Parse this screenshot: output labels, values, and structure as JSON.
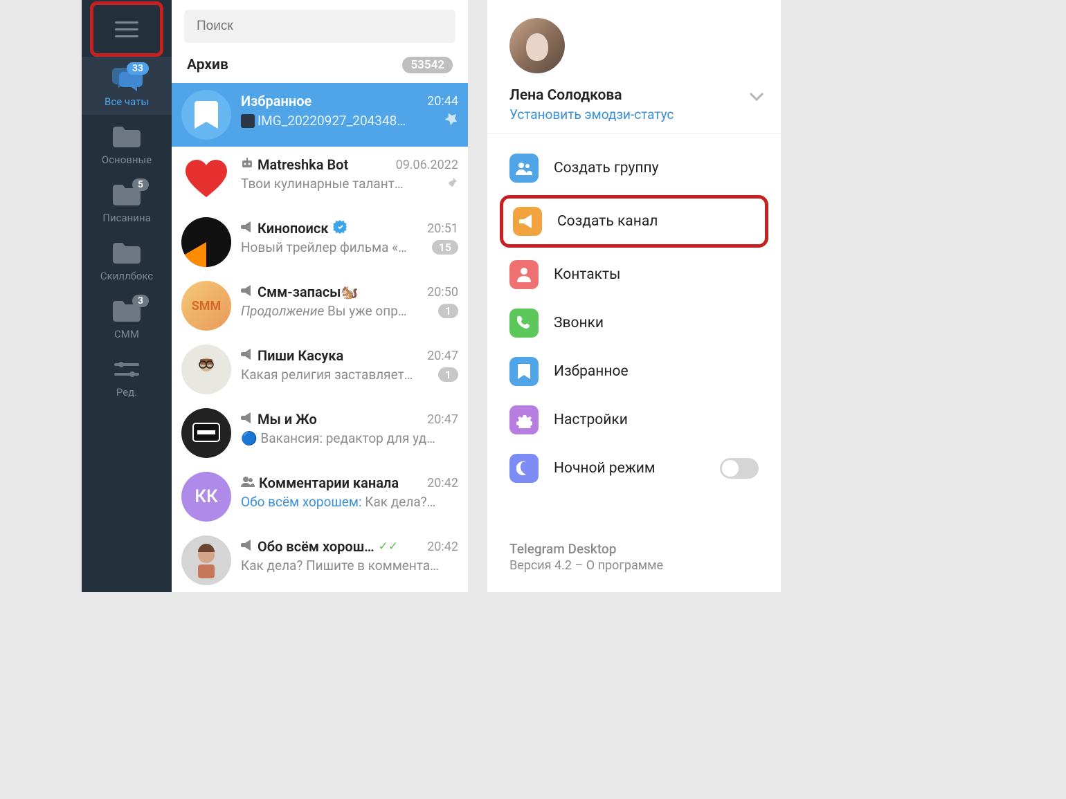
{
  "search": {
    "placeholder": "Поиск"
  },
  "sidebar": {
    "folders": [
      {
        "label": "Все чаты",
        "badge": "33",
        "active": true,
        "icon": "chats"
      },
      {
        "label": "Основные",
        "badge": null,
        "icon": "folder"
      },
      {
        "label": "Писанина",
        "badge": "5",
        "icon": "folder"
      },
      {
        "label": "Скиллбокс",
        "badge": null,
        "icon": "folder"
      },
      {
        "label": "СММ",
        "badge": "3",
        "icon": "folder"
      },
      {
        "label": "Ред.",
        "badge": null,
        "icon": "edit"
      }
    ]
  },
  "archive": {
    "label": "Архив",
    "count": "53542"
  },
  "chats": [
    {
      "title": "Избранное",
      "time": "20:44",
      "msg": "IMG_20220927_204348…",
      "pinned": true,
      "selected": true,
      "type": "saved"
    },
    {
      "title": "Matreshka Bot",
      "time": "09.06.2022",
      "msg": "Твои кулинарные талант…",
      "pinned": true,
      "type": "bot"
    },
    {
      "title": "Кинопоиск",
      "time": "20:51",
      "msg": "Новый трейлер фильма «…",
      "unread": "15",
      "verified": true,
      "type": "channel"
    },
    {
      "title": "Смм-запасы🐿️",
      "time": "20:50",
      "msg_prefix": "Продолжение",
      "msg": " Вы уже опр…",
      "unread": "1",
      "type": "channel"
    },
    {
      "title": "Пиши Касука",
      "time": "20:47",
      "msg": "Какая религия заставляет…",
      "unread": "1",
      "type": "channel"
    },
    {
      "title": "Мы и Жо",
      "time": "20:47",
      "msg": "🔵 Вакансия: редактор для уд…",
      "type": "channel"
    },
    {
      "title": "Комментарии канала",
      "time": "20:42",
      "msg_sender": "Обо всём хорошем:",
      "msg": " Как дела?…",
      "type": "group"
    },
    {
      "title": "Обо всём хорош…",
      "time": "20:42",
      "msg": "Как дела? Пишите в коммента…",
      "checks": true,
      "type": "channel"
    }
  ],
  "profile": {
    "name": "Лена Солодкова",
    "status": "Установить эмодзи-статус"
  },
  "menu": [
    {
      "label": "Создать группу",
      "icon_color": "#4fa5e8",
      "icon": "group"
    },
    {
      "label": "Создать канал",
      "icon_color": "#f0a33e",
      "icon": "megaphone",
      "highlighted": true
    },
    {
      "label": "Контакты",
      "icon_color": "#ef7171",
      "icon": "person"
    },
    {
      "label": "Звонки",
      "icon_color": "#5cc85c",
      "icon": "phone"
    },
    {
      "label": "Избранное",
      "icon_color": "#4fa5e8",
      "icon": "bookmark"
    },
    {
      "label": "Настройки",
      "icon_color": "#b77de0",
      "icon": "gear"
    },
    {
      "label": "Ночной режим",
      "icon_color": "#7e8df5",
      "icon": "moon",
      "toggle": true
    }
  ],
  "footer": {
    "title": "Telegram Desktop",
    "sub": "Версия 4.2 – О программе"
  }
}
